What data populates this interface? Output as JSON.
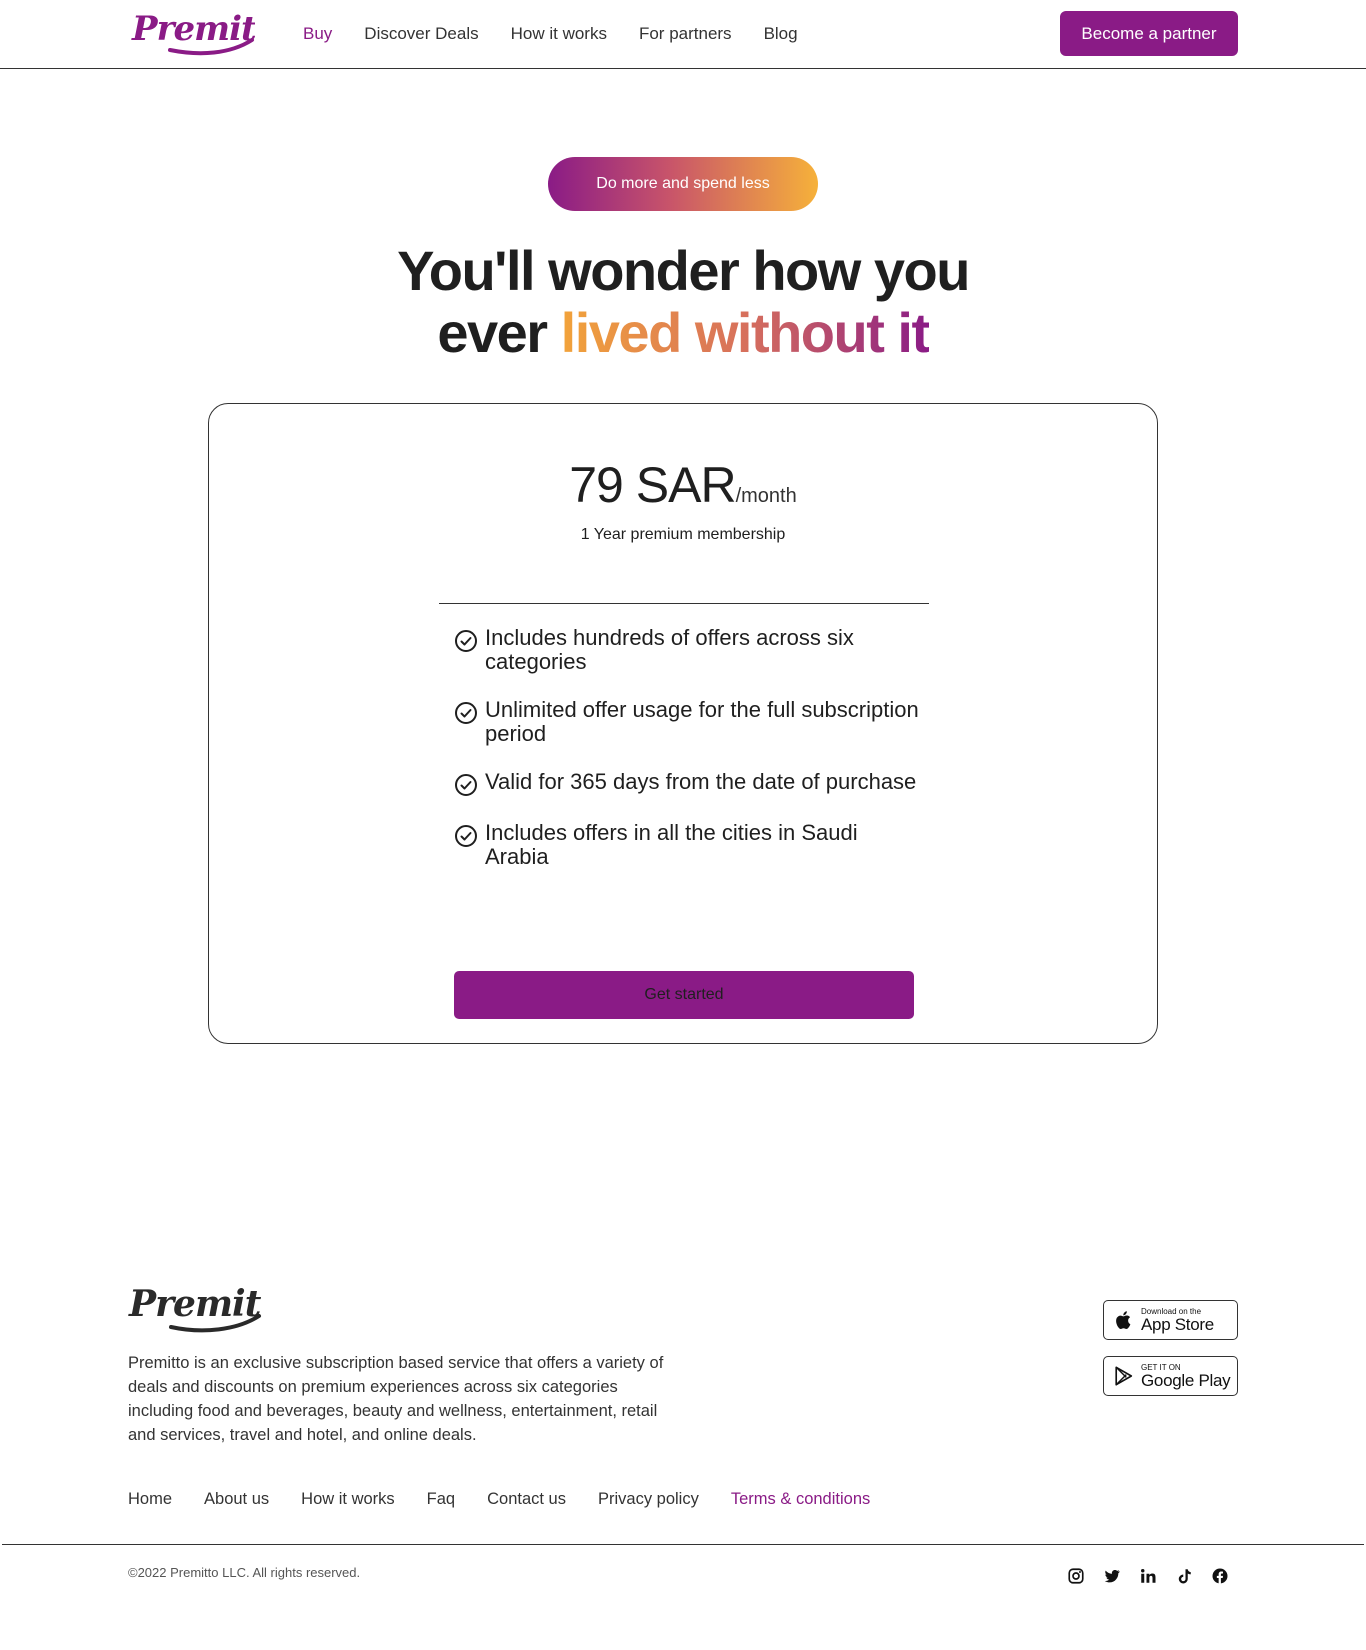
{
  "header": {
    "logo_text": "Premitto",
    "nav": [
      {
        "label": "Buy",
        "active": true
      },
      {
        "label": "Discover Deals",
        "active": false
      },
      {
        "label": "How it works",
        "active": false
      },
      {
        "label": "For partners",
        "active": false
      },
      {
        "label": "Blog",
        "active": false
      }
    ],
    "partner_button": "Become a partner"
  },
  "hero": {
    "pill": "Do more and spend less",
    "headline_line1": "You'll wonder how you",
    "headline_line2_plain": "ever",
    "headline_line2_gradient": "lived without it"
  },
  "plan": {
    "price": "79 SAR",
    "period": "/month",
    "subtitle": "1 Year premium membership",
    "features": [
      "Includes hundreds of offers across six categories",
      "Unlimited offer usage for the full subscription period",
      "Valid for 365 days from the date of purchase",
      "Includes offers in all the cities in Saudi Arabia"
    ],
    "cta": "Get started"
  },
  "footer": {
    "logo_text": "Premitto",
    "description": "Premitto is an exclusive subscription based service that offers a variety of deals and discounts on premium experiences across six categories including food and beverages, beauty and wellness, entertainment, retail and services, travel and hotel, and online deals.",
    "app_store": {
      "small": "Download on the",
      "big": "App Store"
    },
    "google_play": {
      "small": "GET IT ON",
      "big": "Google Play"
    },
    "links": [
      {
        "label": "Home",
        "accent": false
      },
      {
        "label": "About us",
        "accent": false
      },
      {
        "label": "How it works",
        "accent": false
      },
      {
        "label": "Faq",
        "accent": false
      },
      {
        "label": "Contact us",
        "accent": false
      },
      {
        "label": "Privacy policy",
        "accent": false
      },
      {
        "label": "Terms & conditions",
        "accent": true
      }
    ],
    "copyright": "©2022 Premitto LLC. All rights reserved.",
    "socials": [
      "instagram-icon",
      "twitter-icon",
      "linkedin-icon",
      "tiktok-icon",
      "facebook-icon"
    ]
  },
  "colors": {
    "brand": "#8a1b86",
    "gradient_start": "#8a1b86",
    "gradient_end": "#f6b13a"
  }
}
